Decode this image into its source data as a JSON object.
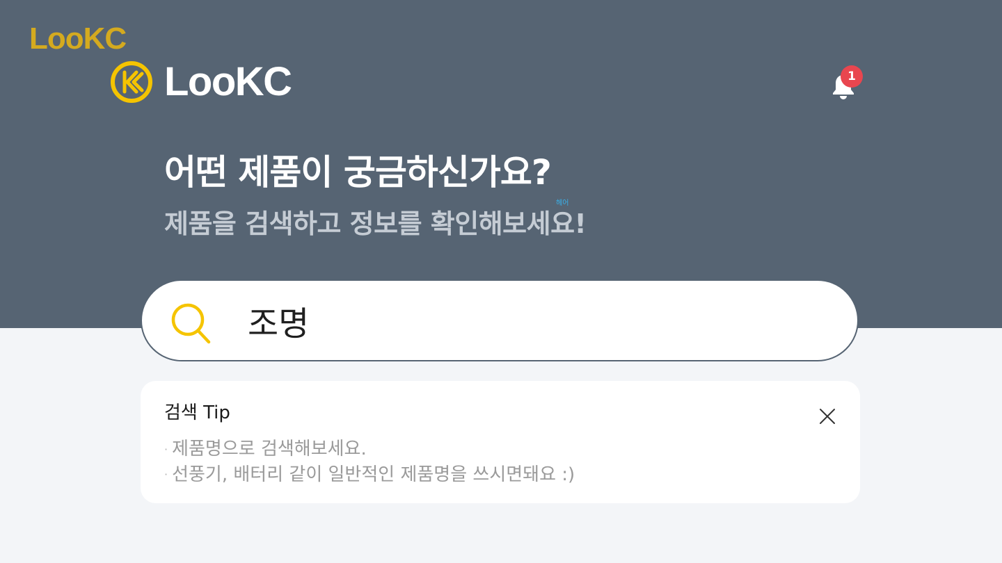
{
  "watermark_logo": "LooKC",
  "header": {
    "brand_name": "LooKC",
    "notification_count": "1"
  },
  "hero": {
    "headline": "어떤 제품이 궁금하신가요?",
    "tiny_label": "헤어",
    "subheadline": "제품을 검색하고 정보를 확인해보세요!"
  },
  "search": {
    "value": "조명"
  },
  "tip": {
    "title": "검색 Tip",
    "lines": [
      "제품명으로 검색해보세요.",
      "선풍기, 배터리 같이 일반적인 제품명을 쓰시면돼요 :)"
    ],
    "bullet": "·"
  },
  "colors": {
    "hero_bg": "#566473",
    "page_bg": "#f3f5f8",
    "accent_yellow": "#f5c400",
    "badge_red": "#e9464f"
  },
  "icons": {
    "brand": "k-circle-logo-icon",
    "notification": "bell-icon",
    "search": "search-icon",
    "close": "close-icon"
  }
}
